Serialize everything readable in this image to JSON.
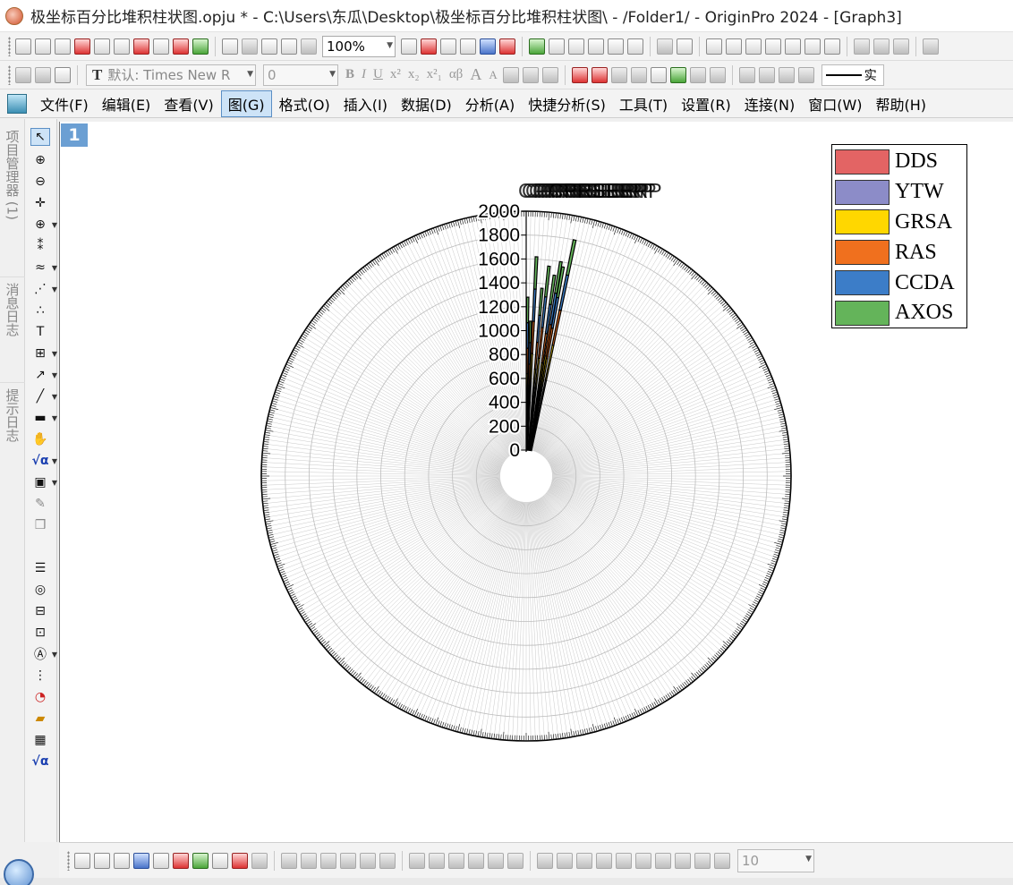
{
  "window": {
    "title": "极坐标百分比堆积柱状图.opju * - C:\\Users\\东瓜\\Desktop\\极坐标百分比堆积柱状图\\ - /Folder1/ - OriginPro 2024 - [Graph3]"
  },
  "toolbar": {
    "zoom": "100%",
    "font_prefix": "T",
    "font": "默认: Times New R",
    "font_size": "0",
    "format_buttons": [
      "B",
      "I",
      "U",
      "x²",
      "x₂",
      "x²₁",
      "αβ",
      "A",
      "A"
    ],
    "line_style_label": "实"
  },
  "menu": {
    "items": [
      "文件(F)",
      "编辑(E)",
      "查看(V)",
      "图(G)",
      "格式(O)",
      "插入(I)",
      "数据(D)",
      "分析(A)",
      "快捷分析(S)",
      "工具(T)",
      "设置(R)",
      "连接(N)",
      "窗口(W)",
      "帮助(H)"
    ],
    "active_index": 3
  },
  "side_tabs": [
    "项目管理器 (1)",
    "消息日志",
    "提示日志"
  ],
  "graph": {
    "layer_badge": "1",
    "bottom_size": "10"
  },
  "legend": [
    {
      "label": "DDS",
      "color": "#e36464"
    },
    {
      "label": "YTW",
      "color": "#8c8cc8"
    },
    {
      "label": "GRSA",
      "color": "#ffd700"
    },
    {
      "label": "RAS",
      "color": "#f0701e"
    },
    {
      "label": "CCDA",
      "color": "#3c7dc8"
    },
    {
      "label": "AXOS",
      "color": "#64b45a"
    }
  ],
  "chart_data": {
    "type": "bar",
    "subtype": "polar stacked",
    "radial_axis": {
      "ticks": [
        "0",
        "200",
        "400",
        "600",
        "800",
        "1000",
        "1200",
        "1400",
        "1600",
        "1800",
        "2000"
      ],
      "range": [
        0,
        2000
      ]
    },
    "overlapping_top_label": "CPRSEERP",
    "series": [
      {
        "name": "DDS",
        "color": "#e36464"
      },
      {
        "name": "YTW",
        "color": "#8c8cc8"
      },
      {
        "name": "GRSA",
        "color": "#ffd700"
      },
      {
        "name": "RAS",
        "color": "#f0701e"
      },
      {
        "name": "CCDA",
        "color": "#3c7dc8"
      },
      {
        "name": "AXOS",
        "color": "#64b45a"
      }
    ],
    "bars": [
      {
        "angle_deg": 0.5,
        "total": 1280
      },
      {
        "angle_deg": 1.6,
        "total": 1080
      },
      {
        "angle_deg": 2.7,
        "total": 1620
      },
      {
        "angle_deg": 4.8,
        "total": 1360
      },
      {
        "angle_deg": 6.2,
        "total": 1550
      },
      {
        "angle_deg": 8.0,
        "total": 1480
      },
      {
        "angle_deg": 9.2,
        "total": 1600
      },
      {
        "angle_deg": 10.0,
        "total": 1560
      },
      {
        "angle_deg": 11.6,
        "total": 1800
      }
    ],
    "grid": true,
    "legend_position": "top-right"
  }
}
